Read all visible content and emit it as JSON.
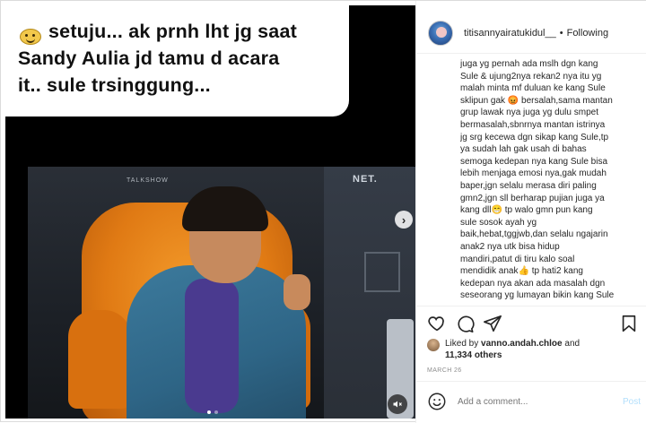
{
  "post": {
    "caption_line1": "setuju... ak prnh lht jg saat",
    "caption_line2": "Sandy Aulia jd tamu d acara",
    "caption_line3": "it.. sule trsinggung...",
    "video_brand": "NET.",
    "video_brand_small": "TALKSHOW",
    "next_icon": "chevron-right-icon",
    "mute_icon": "speaker-muted-icon",
    "carousel_total": 2,
    "carousel_active": 1
  },
  "panel": {
    "username": "titisannyairatukidul__",
    "separator": "•",
    "follow_label": "Following",
    "comment_text": "juga yg pernah ada mslh dgn kang\nSule & ujung2nya rekan2 nya itu yg\nmalah minta mf duluan ke kang Sule\nsklipun gak 😡 bersalah,sama mantan\ngrup lawak nya juga yg dulu smpet\nbermasalah,sbnrnya mantan istrinya\njg srg kecewa dgn sikap kang Sule,tp\nya sudah lah gak usah di bahas\nsemoga kedepan nya kang Sule bisa\nlebih menjaga emosi nya,gak mudah\nbaper,jgn selalu merasa diri paling\ngmn2,jgn sll berharap pujian juga ya\nkang dll😁 tp walo gmn pun kang\nsule sosok ayah yg\nbaik,hebat,tggjwb,dan selalu ngajarin\nanak2 nya utk bisa hidup\nmandiri,patut di tiru kalo soal\nmendidik anak👍 tp hati2 kang\nkedepan nya akan ada masalah dgn\nseseorang yg lumayan bikin kang Sule",
    "icons": {
      "like": "heart-icon",
      "comment": "comment-icon",
      "share": "paper-plane-icon",
      "save": "bookmark-icon"
    },
    "likes_prefix": "Liked by",
    "likes_user": "vanno.andah.chloe",
    "likes_and": "and",
    "likes_others": "11,334 others",
    "date": "MARCH 26",
    "add_comment_placeholder": "Add a comment...",
    "post_label": "Post"
  }
}
